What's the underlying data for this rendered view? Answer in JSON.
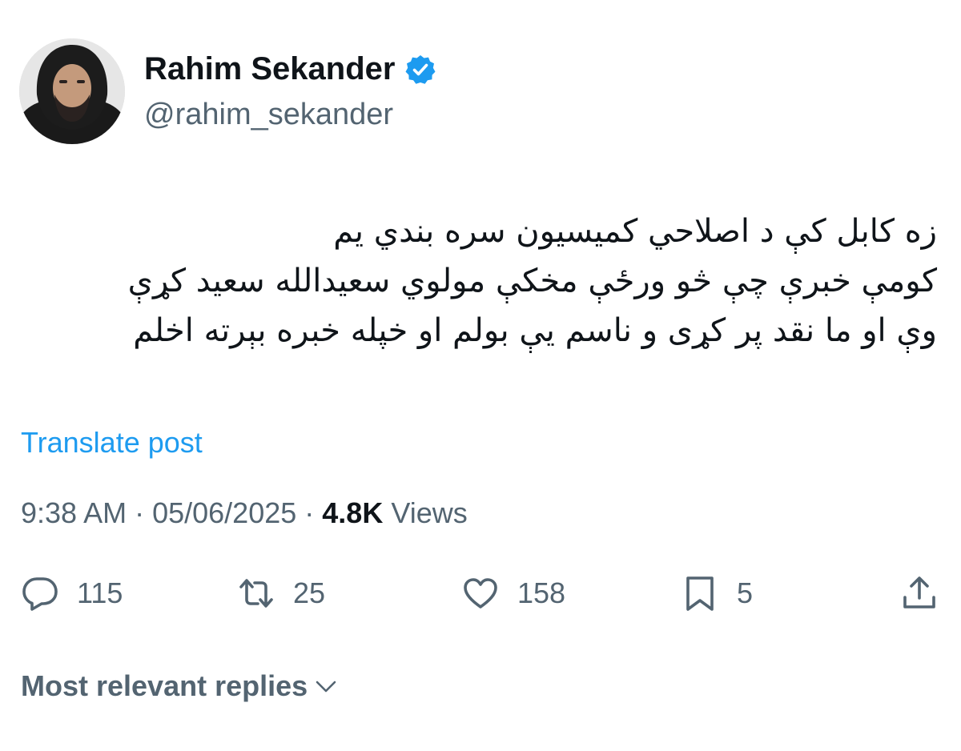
{
  "author": {
    "display_name": "Rahim Sekander",
    "handle": "@rahim_sekander",
    "verified": true
  },
  "tweet": {
    "lines": [
      "زه کابل کې د اصلاحي کمیسیون سره بندي یم",
      "کومې خبرې چې څو ورځې مخکې مولوي سعیدالله سعید کړې",
      "وې او ما نقد پر کړی و ناسم یې بولم او خپله خبره بېرته اخلم"
    ]
  },
  "translate_label": "Translate post",
  "meta": {
    "time": "9:38 AM",
    "separator": " · ",
    "date": "05/06/2025",
    "views_count": "4.8K",
    "views_label": " Views"
  },
  "actions": {
    "reply_count": "115",
    "retweet_count": "25",
    "like_count": "158",
    "bookmark_count": "5"
  },
  "replies_sort_label": "Most relevant replies",
  "colors": {
    "text": "#0f1419",
    "secondary": "#536471",
    "accent": "#1d9bf0"
  },
  "icons": {
    "verified": "verified-badge-icon",
    "reply": "speech-bubble-icon",
    "retweet": "retweet-arrows-icon",
    "like": "heart-icon",
    "bookmark": "bookmark-icon",
    "share": "share-upload-icon",
    "sort": "chevron-down-icon"
  }
}
